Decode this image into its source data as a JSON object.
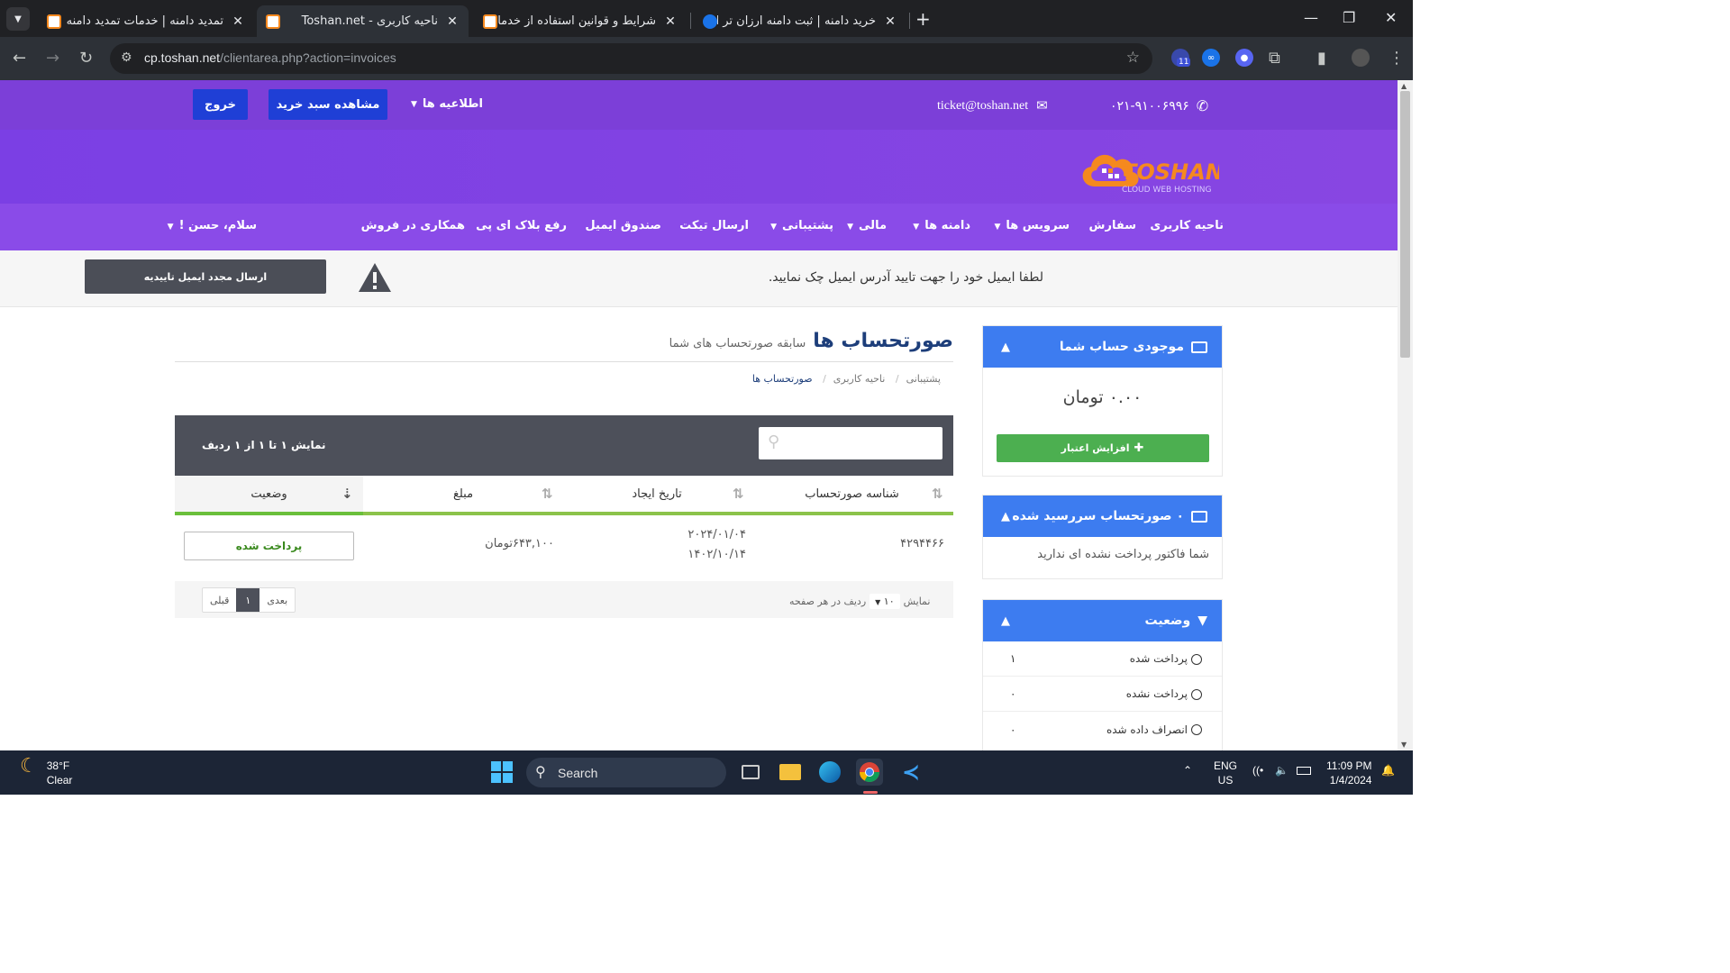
{
  "browser": {
    "tabs": [
      {
        "title": "تمدید دامنه | خدمات تمدید دامنه",
        "active": false
      },
      {
        "title": "ناحیه کاربری - Toshan.net",
        "active": true
      },
      {
        "title": "شرایط و قوانین استفاده از خدمات",
        "active": false
      },
      {
        "title": "خرید دامنه | ثبت دامنه ارزان تر از",
        "active": false
      }
    ],
    "url_host": "cp.toshan.net",
    "url_path": "/clientarea.php?action=invoices",
    "extension_badge": "11"
  },
  "topbar": {
    "phone": "۰۲۱-۹۱۰۰۶۹۹۶",
    "email": "ticket@toshan.net",
    "announcements": "اطلاعیه ها",
    "view_cart": "مشاهده سبد خرید",
    "logout": "خروج"
  },
  "logo": {
    "name": "TOSHAN",
    "tagline": "CLOUD WEB HOSTING"
  },
  "nav": {
    "items": [
      "ناحیه کاربری",
      "سفارش",
      "سرویس ها",
      "دامنه ها",
      "مالی",
      "پشتیبانی",
      "ارسال تیکت",
      "صندوق ایمیل",
      "رفع بلاک ای پی",
      "همکاری در فروش"
    ],
    "greeting": "سلام، حسن !"
  },
  "alert": {
    "message": "لطفا ایمیل خود را جهت تایید آدرس ایمیل چک نمایید.",
    "resend_button": "ارسال مجدد ایمیل تاییدیه"
  },
  "sidebar": {
    "balance": {
      "title": "موجودی حساب شما",
      "amount": "۰.۰۰ تومان",
      "add_credit": "افزایش اعتبار"
    },
    "overdue": {
      "title": "۰ صورتحساب سررسید شده",
      "text": "شما فاکتور پرداخت نشده ای ندارید"
    },
    "status": {
      "title": "وضعیت",
      "items": [
        {
          "label": "پرداخت شده",
          "count": "۱"
        },
        {
          "label": "پرداخت نشده",
          "count": "۰"
        },
        {
          "label": "انصراف داده شده",
          "count": "۰"
        }
      ]
    }
  },
  "main": {
    "title": "صورتحساب ها",
    "subtitle": "سابقه صورتحساب های شما",
    "breadcrumb": [
      "پشتیبانی",
      "ناحیه کاربری",
      "صورتحساب ها"
    ],
    "table_info": "نمایش ۱ تا ۱ از ۱ ردیف",
    "columns": [
      "شناسه صورتحساب",
      "تاریخ ایجاد",
      "مبلغ",
      "وضعیت"
    ],
    "rows": [
      {
        "id": "۴۲۹۴۴۶۶",
        "date_greg": "۲۰۲۴/۰۱/۰۴",
        "date_jalali": "۱۴۰۲/۱۰/۱۴",
        "amount": "۶۴۳,۱۰۰تومان",
        "status": "پرداخت شده"
      }
    ],
    "footer": {
      "show": "نمایش",
      "per_page_value": "۱۰",
      "per_page_suffix": "ردیف در هر صفحه",
      "next": "بعدی",
      "page": "۱",
      "prev": "قبلی"
    }
  },
  "taskbar": {
    "temp": "38°F",
    "condition": "Clear",
    "search": "Search",
    "lang1": "ENG",
    "lang2": "US",
    "time": "11:09 PM",
    "date": "1/4/2024"
  },
  "colors": {
    "purple": "#7c3fd8",
    "blue_button": "#1f3fd6",
    "panel_blue": "#3d7cf0",
    "green": "#4caf50"
  }
}
